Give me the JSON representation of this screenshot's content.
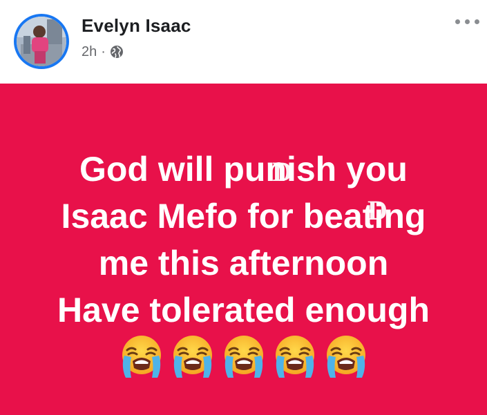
{
  "author": {
    "name": "Evelyn Isaac",
    "time": "2h",
    "separator": "·",
    "audience_icon": "globe-icon"
  },
  "header": {
    "more_icon": "more-options-icon"
  },
  "post": {
    "background_color": "#e8114a",
    "lines": [
      "God will punish you",
      "Isaac Mefo for beating",
      "me this afternoon",
      "Have tolerated enough"
    ],
    "emoji_name": "loudly-crying-face-icon",
    "emoji_count": 5
  },
  "watermark": {
    "marks": [
      "D",
      "D"
    ],
    "icon": "d-watermark-icon"
  }
}
